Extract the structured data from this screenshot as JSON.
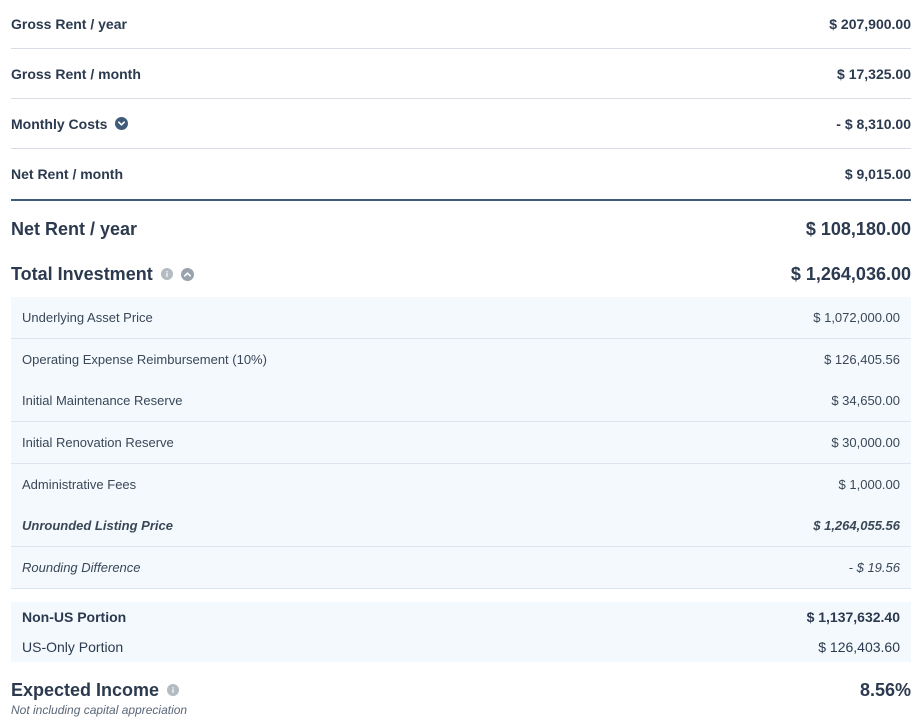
{
  "summary": [
    {
      "label": "Gross Rent / year",
      "value": "$ 207,900.00"
    },
    {
      "label": "Gross Rent / month",
      "value": "$ 17,325.00"
    },
    {
      "label": "Monthly Costs",
      "value": "- $ 8,310.00"
    },
    {
      "label": "Net Rent / month",
      "value": "$ 9,015.00"
    }
  ],
  "net_rent_year": {
    "label": "Net Rent / year",
    "value": "$ 108,180.00"
  },
  "total_investment": {
    "label": "Total Investment",
    "value": "$ 1,264,036.00"
  },
  "investment_items": [
    {
      "label": "Underlying Asset Price",
      "value": "$ 1,072,000.00"
    },
    {
      "label": "Operating Expense Reimbursement (10%)",
      "value": "$ 126,405.56"
    },
    {
      "label": "Initial Maintenance Reserve",
      "value": "$ 34,650.00"
    },
    {
      "label": "Initial Renovation Reserve",
      "value": "$ 30,000.00"
    },
    {
      "label": "Administrative Fees",
      "value": "$ 1,000.00"
    },
    {
      "label": "Unrounded Listing Price",
      "value": "$ 1,264,055.56"
    },
    {
      "label": "Rounding Difference",
      "value": "- $ 19.56"
    }
  ],
  "portions": [
    {
      "label": "Non-US Portion",
      "value": "$ 1,137,632.40"
    },
    {
      "label": "US-Only Portion",
      "value": "$ 126,403.60"
    }
  ],
  "expected_income": {
    "label": "Expected Income",
    "value": "8.56%",
    "note": "Not including capital appreciation"
  },
  "colors": {
    "text": "#2c3a4f",
    "accent": "#3f5b7a",
    "panel": "#f3f9fd",
    "divider": "#3f5b7a"
  },
  "icons": {
    "monthly_costs": "chevron-down-circle-icon",
    "total_investment_info": "info-icon",
    "total_investment_toggle": "chevron-up-circle-icon",
    "expected_income_info": "info-icon"
  }
}
